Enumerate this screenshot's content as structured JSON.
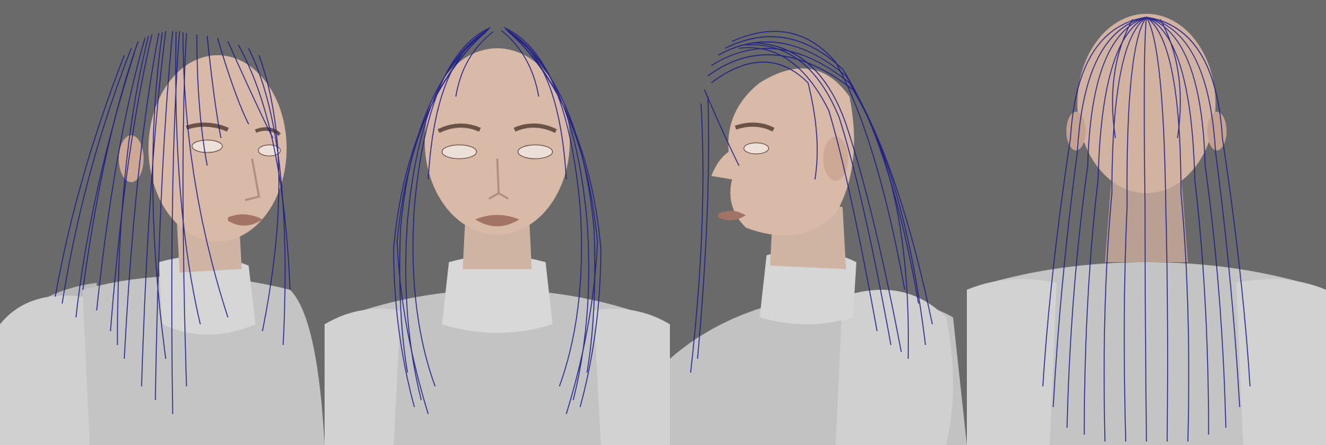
{
  "scene": {
    "background_color": "#6a6a6a",
    "hair_guide_color": "#1c1c8c",
    "skin_color": "#d9b9a7",
    "body_color": "#c9c9c9",
    "views": [
      {
        "name": "three-quarter-left",
        "icon": "head-three-quarter-view"
      },
      {
        "name": "front",
        "icon": "head-front-view"
      },
      {
        "name": "profile-left",
        "icon": "head-profile-view"
      },
      {
        "name": "back",
        "icon": "head-back-view"
      }
    ]
  }
}
